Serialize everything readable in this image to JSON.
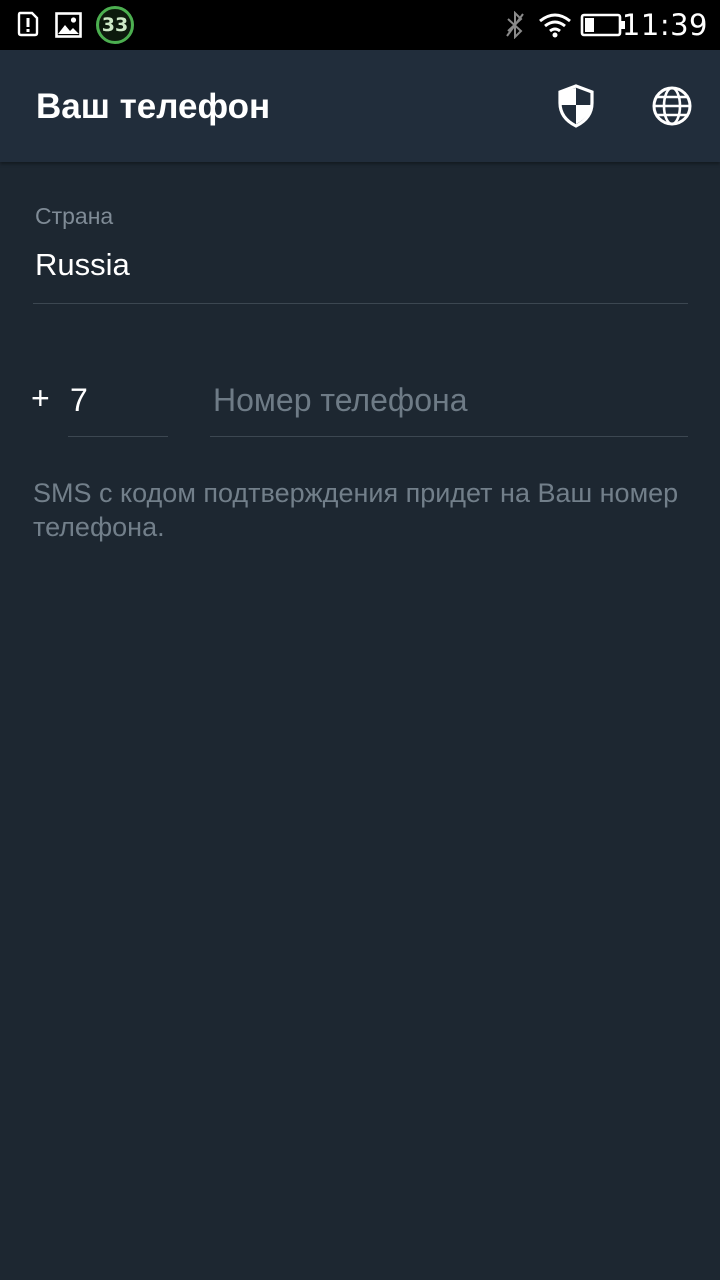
{
  "status_bar": {
    "time": "11:39",
    "notification_badge": "33",
    "icons": [
      "alert-icon",
      "image-icon",
      "bluetooth-icon",
      "wifi-icon",
      "battery-icon"
    ]
  },
  "app_bar": {
    "title": "Ваш телефон",
    "actions": [
      "shield-icon",
      "globe-icon"
    ],
    "background": "#212d3b"
  },
  "form": {
    "country_label": "Страна",
    "country_value": "Russia",
    "phone_prefix": "+",
    "country_code": "7",
    "phone_placeholder": "Номер телефона",
    "phone_value": ""
  },
  "hint": "SMS с кодом подтверждения придет на Ваш номер телефона.",
  "colors": {
    "background": "#1d2731",
    "status_bar": "#000000",
    "badge_ring": "#4caf50",
    "text_primary": "#ffffff",
    "text_secondary": "#727f8a"
  }
}
